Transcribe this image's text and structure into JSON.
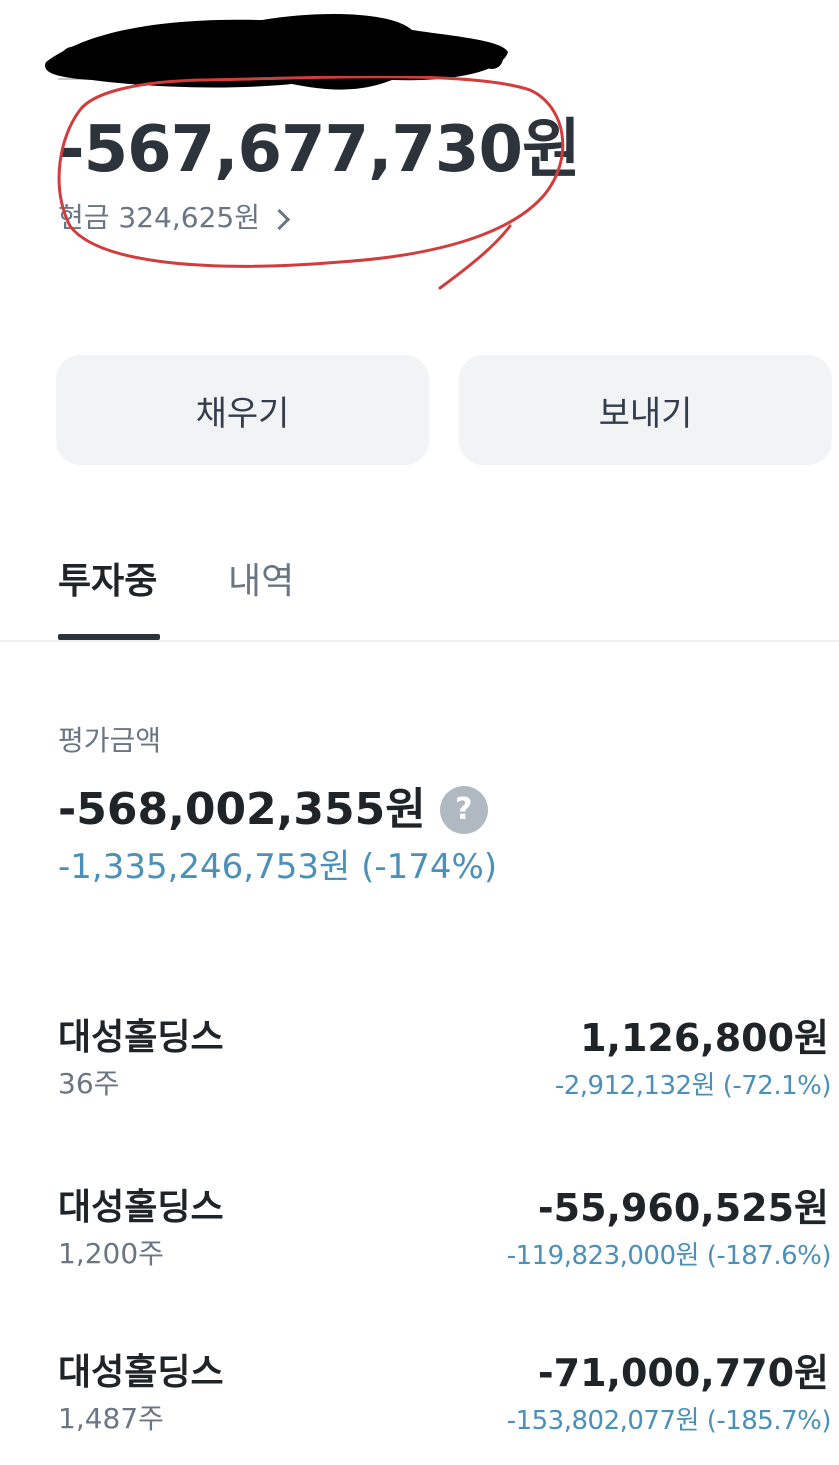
{
  "header": {
    "redacted_label": "",
    "total_amount": "-567,677,730원",
    "cash_label": "현금 324,625원"
  },
  "actions": {
    "fill_label": "채우기",
    "send_label": "보내기"
  },
  "tabs": [
    {
      "label": "투자중",
      "active": true
    },
    {
      "label": "내역",
      "active": false
    }
  ],
  "valuation": {
    "label": "평가금액",
    "amount": "-568,002,355원",
    "help_symbol": "?",
    "change": "-1,335,246,753원 (-174%)"
  },
  "holdings": [
    {
      "name": "대성홀딩스",
      "quantity": "36주",
      "value": "1,126,800원",
      "change": "-2,912,132원 (-72.1%)"
    },
    {
      "name": "대성홀딩스",
      "quantity": "1,200주",
      "value": "-55,960,525원",
      "change": "-119,823,000원 (-187.6%)"
    },
    {
      "name": "대성홀딩스",
      "quantity": "1,487주",
      "value": "-71,000,770원",
      "change": "-153,802,077원 (-185.7%)"
    }
  ],
  "colors": {
    "text_primary": "#1f2428",
    "text_secondary": "#6b7684",
    "change_blue": "#4a90b8",
    "button_bg": "#f2f3f5",
    "annotation_red": "#d23c3c",
    "redaction_black": "#000000"
  },
  "icons": {
    "help": "question-circle-icon",
    "chevron": "chevron-right-icon"
  }
}
